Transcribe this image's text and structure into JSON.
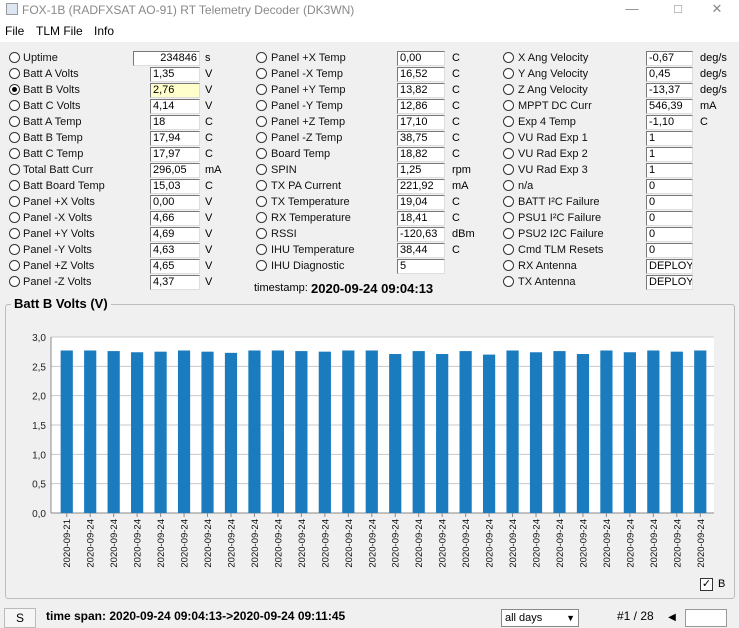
{
  "window": {
    "title": "FOX-1B (RADFXSAT AO-91) RT Telemetry Decoder  (DK3WN)"
  },
  "menu": [
    "File",
    "TLM File",
    "Info"
  ],
  "columns": [
    [
      {
        "label": "Uptime",
        "value": "234846",
        "unit": "s",
        "align": "right"
      },
      {
        "label": "Batt A Volts",
        "value": "1,35",
        "unit": "V"
      },
      {
        "label": "Batt B Volts",
        "value": "2,76",
        "unit": "V",
        "selected": true
      },
      {
        "label": "Batt C Volts",
        "value": "4,14",
        "unit": "V"
      },
      {
        "label": "Batt A Temp",
        "value": "18",
        "unit": "C"
      },
      {
        "label": "Batt B Temp",
        "value": "17,94",
        "unit": "C"
      },
      {
        "label": "Batt C Temp",
        "value": "17,97",
        "unit": "C"
      },
      {
        "label": "Total Batt Curr",
        "value": "296,05",
        "unit": "mA"
      },
      {
        "label": "Batt Board Temp",
        "value": "15,03",
        "unit": "C"
      },
      {
        "label": "Panel +X Volts",
        "value": "0,00",
        "unit": "V"
      },
      {
        "label": "Panel -X Volts",
        "value": "4,66",
        "unit": "V"
      },
      {
        "label": "Panel +Y Volts",
        "value": "4,69",
        "unit": "V"
      },
      {
        "label": "Panel -Y Volts",
        "value": "4,63",
        "unit": "V"
      },
      {
        "label": "Panel +Z Volts",
        "value": "4,65",
        "unit": "V"
      },
      {
        "label": "Panel -Z Volts",
        "value": "4,37",
        "unit": "V"
      }
    ],
    [
      {
        "label": "Panel +X Temp",
        "value": "0,00",
        "unit": "C"
      },
      {
        "label": "Panel -X Temp",
        "value": "16,52",
        "unit": "C"
      },
      {
        "label": "Panel +Y Temp",
        "value": "13,82",
        "unit": "C"
      },
      {
        "label": "Panel -Y Temp",
        "value": "12,86",
        "unit": "C"
      },
      {
        "label": "Panel +Z Temp",
        "value": "17,10",
        "unit": "C"
      },
      {
        "label": "Panel -Z Temp",
        "value": "38,75",
        "unit": "C"
      },
      {
        "label": "Board Temp",
        "value": "18,82",
        "unit": "C"
      },
      {
        "label": "SPIN",
        "value": "1,25",
        "unit": "rpm"
      },
      {
        "label": "TX PA Current",
        "value": "221,92",
        "unit": "mA"
      },
      {
        "label": "TX Temperature",
        "value": "19,04",
        "unit": "C"
      },
      {
        "label": "RX Temperature",
        "value": "18,41",
        "unit": "C"
      },
      {
        "label": "RSSI",
        "value": "-120,63",
        "unit": "dBm"
      },
      {
        "label": "IHU Temperature",
        "value": "38,44",
        "unit": "C"
      },
      {
        "label": "IHU Diagnostic",
        "value": "5",
        "unit": ""
      }
    ],
    [
      {
        "label": "X Ang Velocity",
        "value": "-0,67",
        "unit": "deg/s"
      },
      {
        "label": "Y Ang Velocity",
        "value": "0,45",
        "unit": "deg/s"
      },
      {
        "label": "Z Ang Velocity",
        "value": "-13,37",
        "unit": "deg/s"
      },
      {
        "label": "MPPT DC Curr",
        "value": "546,39",
        "unit": "mA"
      },
      {
        "label": "Exp 4 Temp",
        "value": "-1,10",
        "unit": "C"
      },
      {
        "label": "VU Rad Exp 1",
        "value": "1",
        "unit": ""
      },
      {
        "label": "VU Rad Exp 2",
        "value": "1",
        "unit": ""
      },
      {
        "label": "VU Rad Exp 3",
        "value": "1",
        "unit": ""
      },
      {
        "label": "n/a",
        "value": "0",
        "unit": ""
      },
      {
        "label": "BATT I²C Failure",
        "value": "0",
        "unit": ""
      },
      {
        "label": "PSU1 I²C Failure",
        "value": "0",
        "unit": ""
      },
      {
        "label": "PSU2 I2C Failure",
        "value": "0",
        "unit": ""
      },
      {
        "label": "Cmd TLM Resets",
        "value": "0",
        "unit": ""
      },
      {
        "label": "RX Antenna",
        "value": "DEPLOY",
        "unit": ""
      },
      {
        "label": "TX Antenna",
        "value": "DEPLOY",
        "unit": ""
      }
    ]
  ],
  "timestamp": {
    "label": "timestamp:",
    "value": "2020-09-24  09:04:13"
  },
  "chart_panel_title": "Batt B Volts (V)",
  "chart_data": {
    "type": "bar",
    "title": "",
    "color": "#1a7bbf",
    "ylim": [
      0,
      3.0
    ],
    "yticks": [
      "0,0",
      "0,5",
      "1,0",
      "1,5",
      "2,0",
      "2,5",
      "3,0"
    ],
    "categories": [
      "2020-09-21",
      "2020-09-24",
      "2020-09-24",
      "2020-09-24",
      "2020-09-24",
      "2020-09-24",
      "2020-09-24",
      "2020-09-24",
      "2020-09-24",
      "2020-09-24",
      "2020-09-24",
      "2020-09-24",
      "2020-09-24",
      "2020-09-24",
      "2020-09-24",
      "2020-09-24",
      "2020-09-24",
      "2020-09-24",
      "2020-09-24",
      "2020-09-24",
      "2020-09-24",
      "2020-09-24",
      "2020-09-24",
      "2020-09-24",
      "2020-09-24",
      "2020-09-24",
      "2020-09-24",
      "2020-09-24"
    ],
    "values": [
      2.77,
      2.77,
      2.76,
      2.74,
      2.75,
      2.77,
      2.75,
      2.73,
      2.77,
      2.77,
      2.76,
      2.75,
      2.77,
      2.77,
      2.71,
      2.76,
      2.71,
      2.76,
      2.7,
      2.77,
      2.74,
      2.76,
      2.71,
      2.77,
      2.74,
      2.77,
      2.75,
      2.77
    ],
    "legend": "B",
    "legend_checked": true
  },
  "status": {
    "s_button": "S",
    "time_span": "time span:  2020-09-24 09:04:13->2020-09-24 09:11:45",
    "days_select": "all days",
    "page": "#1 / 28"
  }
}
